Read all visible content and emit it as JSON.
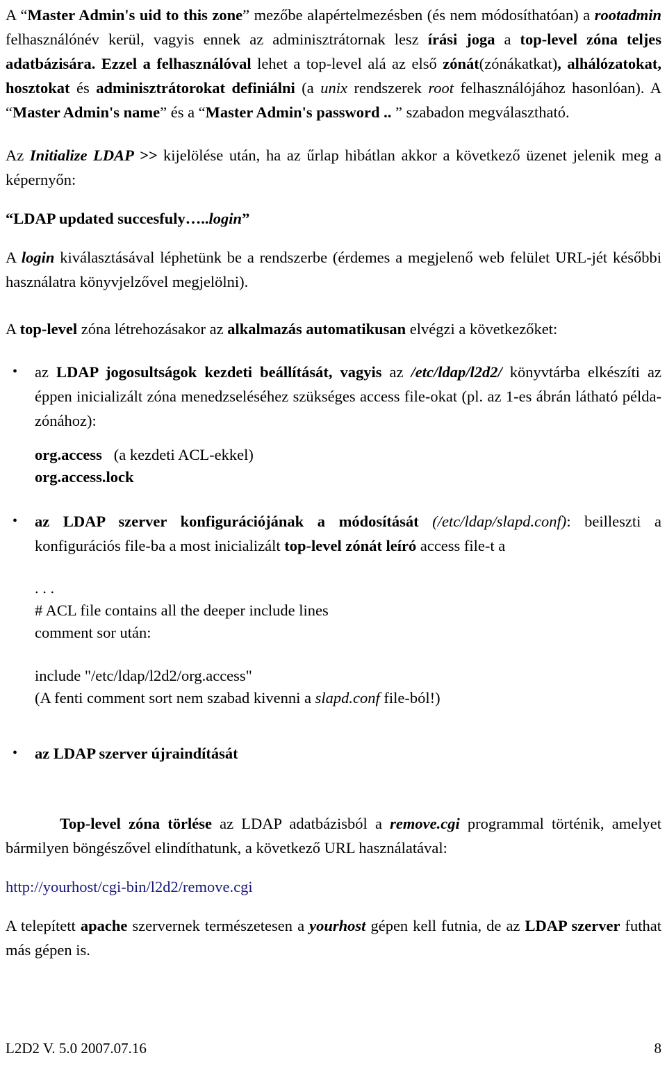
{
  "document": {
    "language": "hu",
    "text_color": "#000000",
    "link_color": "#19197a",
    "background": "#ffffff"
  },
  "body": {
    "para1": {
      "s1": "A “",
      "s2": "Master Admin's uid to this zone",
      "s3": "” mezőbe alapértelmezésben (és nem módosíthatóan) a ",
      "s4": "rootadmin",
      "s5": " felhasználónév kerül, vagyis ennek az adminisztrátornak lesz ",
      "s6": "írási joga",
      "s7": " a ",
      "s8": "top-level zóna teljes adatbázisára. Ezzel a felhasználóval",
      "s9": " lehet a top-level alá az első ",
      "s10": "zónát",
      "s11": "(zónákatkat)",
      "s12": ", alhálózatokat, hosztokat",
      "s13": " és ",
      "s14": "adminisztrátorokat definiálni",
      "s15": " (a ",
      "s16": "unix",
      "s17": " rendszerek ",
      "s18": "root",
      "s19": " felhasználójához hasonlóan). A “",
      "s20": "Master Admin's  name",
      "s21": "” és a “",
      "s22": "Master Admin's password ..",
      "s23": " ” szabadon megválasztható."
    },
    "para2": {
      "s1": "Az ",
      "s2": "Initialize LDAP >>",
      "s3": " kijelölése után, ha az űrlap hibátlan akkor a következő üzenet jelenik meg a képernyőn:"
    },
    "message_line": {
      "s1": "“LDAP updated succesfuly…..",
      "s2": "login",
      "s3": "”"
    },
    "para3": {
      "s1": "A ",
      "s2": "login",
      "s3": " kiválasztásával léphetünk be a rendszerbe (érdemes a megjelenő web felület URL-jét későbbi használatra könyvjelzővel megjelölni)."
    },
    "para4": {
      "s1": "A ",
      "s2": "top-level",
      "s3": " zóna létrehozásakor az ",
      "s4": "alkalmazás automatikusan",
      "s5": " elvégzi a következőket:"
    },
    "bullets": [
      {
        "marker": "•",
        "s1": "az ",
        "s2": "LDAP jogosultságok kezdeti beállítását, vagyis",
        "s3": " az ",
        "s4": "/etc/ldap/l2d2/",
        "s5": " könyvtárba elkészíti az éppen inicializált zóna menedzseléséhez szükséges access file-okat (pl. az 1-es ábrán látható  példa-zónához):"
      },
      {
        "marker": "•",
        "s1": "az LDAP szerver konfigurációjának a módosítását",
        "s2": " ",
        "s3": "(/etc/ldap/slapd.conf)",
        "s4": ": beilleszti a konfigurációs file-ba a most inicializált ",
        "s5": "top-level zónát leíró",
        "s6": " access file-t a"
      },
      {
        "marker": "•",
        "s1": "az LDAP szerver újraindítását"
      }
    ],
    "code1": {
      "line1_bold": "org.access",
      "line1_rest": "   (a kezdeti ACL-ekkel)",
      "line2_bold": "org.access.lock"
    },
    "code2": {
      "line1": ". . .",
      "line2": "# ACL file contains all the deeper include lines",
      "line3": "comment sor után:"
    },
    "code3": {
      "line1": "include \"/etc/ldap/l2d2/org.access\"",
      "line2_a": "(A fenti comment sort nem szabad kivenni a ",
      "line2_b": "slapd.conf",
      "line2_c": " file-ból!)"
    },
    "para5": {
      "s1": "Top-level zóna törlése",
      "s2": " az LDAP adatbázisból a ",
      "s3": "remove.cgi",
      "s4": " programmal történik, amelyet bármilyen böngészővel elindíthatunk, a következő URL használatával:"
    },
    "url": "http://yourhost/cgi-bin/l2d2/remove.cgi",
    "para6": {
      "s1": "A telepített ",
      "s2": "apache",
      "s3": " szervernek természetesen a ",
      "s4": "yourhost",
      "s5": " gépen kell futnia, de az ",
      "s6": "LDAP szerver",
      "s7": " futhat más gépen is."
    }
  },
  "footer": {
    "left": "L2D2 V. 5.0  2007.07.16",
    "page_number": "8"
  }
}
